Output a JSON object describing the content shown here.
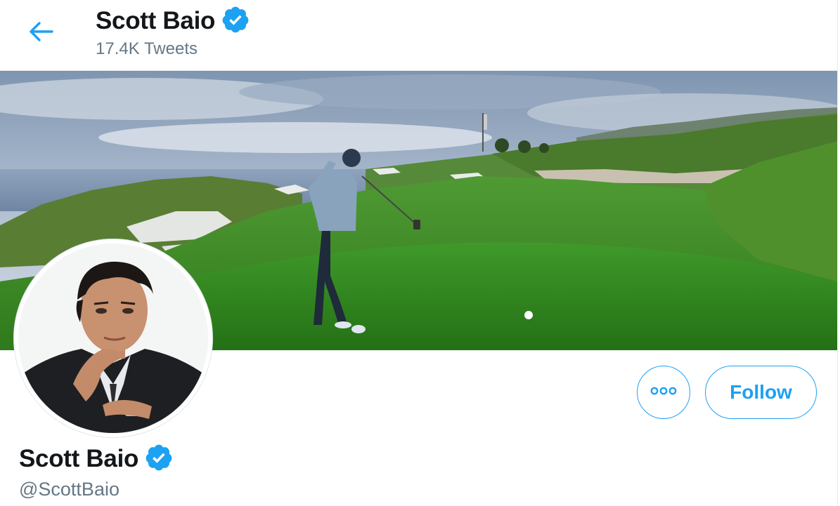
{
  "header": {
    "name": "Scott Baio",
    "tweet_count": "17.4K Tweets",
    "verified": true
  },
  "profile": {
    "name": "Scott Baio",
    "handle": "@ScottBaio",
    "verified": true
  },
  "actions": {
    "more_icon": "more-dots-icon",
    "follow_label": "Follow"
  },
  "icons": {
    "back": "arrow-left-icon",
    "verified": "verified-badge-icon"
  },
  "colors": {
    "accent": "#1da1f2",
    "text_primary": "#14171a",
    "text_secondary": "#657786",
    "divider": "#e6ecf0"
  }
}
